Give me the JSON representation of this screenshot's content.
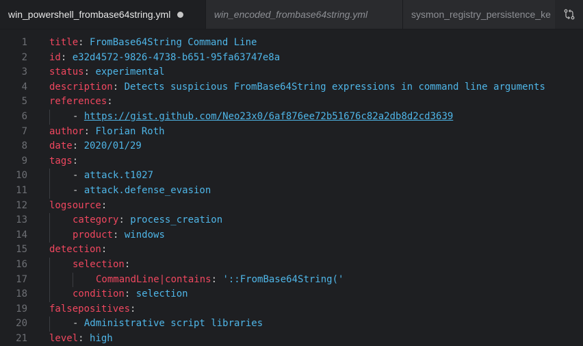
{
  "tabs": [
    {
      "label": "win_powershell_frombase64string.yml",
      "dirty": true
    },
    {
      "label": "win_encoded_frombase64string.yml"
    },
    {
      "label": "sysmon_registry_persistence_ke"
    }
  ],
  "actions": {
    "icon": "source-control-compare-icon"
  },
  "lines": [
    {
      "num": "1",
      "key": "title",
      "sep": ": ",
      "val": "FromBase64String Command Line"
    },
    {
      "num": "2",
      "key": "id",
      "sep": ": ",
      "val": "e32d4572-9826-4738-b651-95fa63747e8a"
    },
    {
      "num": "3",
      "key": "status",
      "sep": ": ",
      "val": "experimental"
    },
    {
      "num": "4",
      "key": "description",
      "sep": ": ",
      "val": "Detects suspicious FromBase64String expressions in command line arguments"
    },
    {
      "num": "5",
      "key": "references",
      "sep": ":",
      "val": ""
    },
    {
      "num": "6",
      "dash": "- ",
      "url": "https://gist.github.com/Neo23x0/6af876ee72b51676c82a2db8d2cd3639"
    },
    {
      "num": "7",
      "key": "author",
      "sep": ": ",
      "val": "Florian Roth"
    },
    {
      "num": "8",
      "key": "date",
      "sep": ": ",
      "val": "2020/01/29"
    },
    {
      "num": "9",
      "key": "tags",
      "sep": ":",
      "val": ""
    },
    {
      "num": "10",
      "dash": "- ",
      "val": "attack.t1027"
    },
    {
      "num": "11",
      "dash": "- ",
      "val": "attack.defense_evasion"
    },
    {
      "num": "12",
      "key": "logsource",
      "sep": ":",
      "val": ""
    },
    {
      "num": "13",
      "key": "category",
      "sep": ": ",
      "val": "process_creation"
    },
    {
      "num": "14",
      "key": "product",
      "sep": ": ",
      "val": "windows"
    },
    {
      "num": "15",
      "key": "detection",
      "sep": ":",
      "val": ""
    },
    {
      "num": "16",
      "key": "selection",
      "sep": ":",
      "val": ""
    },
    {
      "num": "17",
      "key": "CommandLine|contains",
      "sep": ": ",
      "val": "'::FromBase64String('"
    },
    {
      "num": "18",
      "key": "condition",
      "sep": ": ",
      "val": "selection"
    },
    {
      "num": "19",
      "key": "falsepositives",
      "sep": ":",
      "val": ""
    },
    {
      "num": "20",
      "dash": "- ",
      "val": "Administrative script libraries"
    },
    {
      "num": "21",
      "key": "level",
      "sep": ": ",
      "val": "high"
    }
  ]
}
